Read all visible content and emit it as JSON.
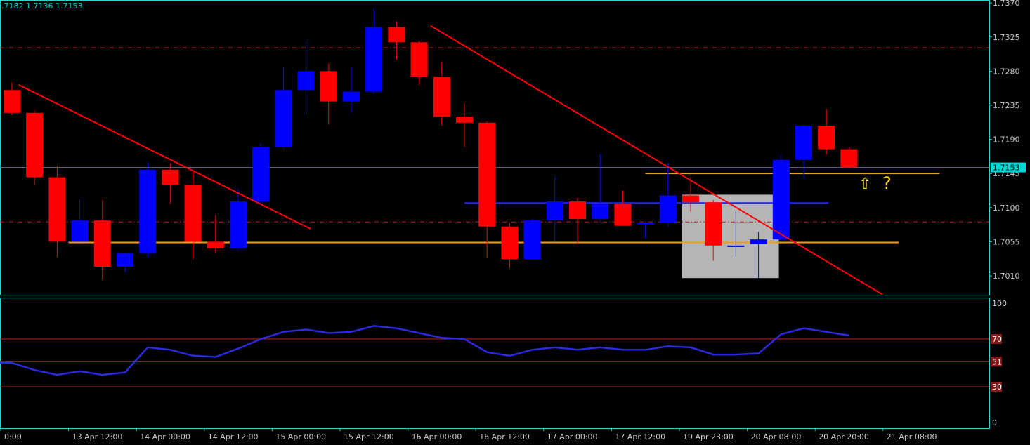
{
  "header": {
    "ohlc_text": ".7182 1.7136 1.7153"
  },
  "colors": {
    "background": "#000000",
    "frame": "#2fd2d2",
    "bull": "#0000ff",
    "bear": "#ff0000",
    "trendline": "#ff0000",
    "support": "#ff9d00",
    "hline": "#2222ff",
    "rsi": "#2a2ae0",
    "level": "#d01616",
    "grey_box": "#bfbfbf",
    "price_badge": "#00d7d7",
    "annotation": "#ffe000"
  },
  "chart_data": [
    {
      "type": "candlestick",
      "symbol_ohlc_text": ".7182 1.7136 1.7153",
      "current_price": 1.7153,
      "current_price_label": "1.7153",
      "ylim": [
        1.6985,
        1.7372
      ],
      "y_ticks": [
        "1.7370",
        "1.7325",
        "1.7280",
        "1.7235",
        "1.7190",
        "1.7145",
        "1.7100",
        "1.7055",
        "1.7010"
      ],
      "x_ticks": [
        {
          "i": 0,
          "label": "0:00"
        },
        {
          "i": 3,
          "label": "13 Apr 12:00"
        },
        {
          "i": 6,
          "label": "14 Apr 00:00"
        },
        {
          "i": 9,
          "label": "14 Apr 12:00"
        },
        {
          "i": 12,
          "label": "15 Apr 00:00"
        },
        {
          "i": 15,
          "label": "15 Apr 12:00"
        },
        {
          "i": 18,
          "label": "16 Apr 00:00"
        },
        {
          "i": 21,
          "label": "16 Apr 12:00"
        },
        {
          "i": 24,
          "label": "17 Apr 00:00"
        },
        {
          "i": 27,
          "label": "17 Apr 12:00"
        },
        {
          "i": 30,
          "label": "19 Apr 23:00"
        },
        {
          "i": 33,
          "label": "20 Apr 08:00"
        },
        {
          "i": 36,
          "label": "20 Apr 20:00"
        },
        {
          "i": 39,
          "label": "21 Apr 08:00"
        }
      ],
      "candles": [
        {
          "o": 1.7255,
          "h": 1.7265,
          "l": 1.7222,
          "c": 1.7225
        },
        {
          "o": 1.7225,
          "h": 1.7228,
          "l": 1.713,
          "c": 1.714
        },
        {
          "o": 1.714,
          "h": 1.7155,
          "l": 1.7035,
          "c": 1.7055
        },
        {
          "o": 1.7055,
          "h": 1.711,
          "l": 1.7055,
          "c": 1.7083
        },
        {
          "o": 1.7083,
          "h": 1.711,
          "l": 1.7005,
          "c": 1.7022
        },
        {
          "o": 1.7022,
          "h": 1.704,
          "l": 1.7015,
          "c": 1.704
        },
        {
          "o": 1.704,
          "h": 1.716,
          "l": 1.7035,
          "c": 1.715
        },
        {
          "o": 1.715,
          "h": 1.7158,
          "l": 1.7105,
          "c": 1.713
        },
        {
          "o": 1.713,
          "h": 1.715,
          "l": 1.7032,
          "c": 1.7055
        },
        {
          "o": 1.7055,
          "h": 1.709,
          "l": 1.704,
          "c": 1.7046
        },
        {
          "o": 1.7046,
          "h": 1.7125,
          "l": 1.7044,
          "c": 1.7108
        },
        {
          "o": 1.7108,
          "h": 1.7185,
          "l": 1.7105,
          "c": 1.718
        },
        {
          "o": 1.718,
          "h": 1.7285,
          "l": 1.7177,
          "c": 1.7255
        },
        {
          "o": 1.7255,
          "h": 1.732,
          "l": 1.7222,
          "c": 1.728
        },
        {
          "o": 1.728,
          "h": 1.729,
          "l": 1.721,
          "c": 1.724
        },
        {
          "o": 1.724,
          "h": 1.7285,
          "l": 1.7225,
          "c": 1.7253
        },
        {
          "o": 1.7253,
          "h": 1.7362,
          "l": 1.725,
          "c": 1.7338
        },
        {
          "o": 1.7338,
          "h": 1.7346,
          "l": 1.7295,
          "c": 1.7318
        },
        {
          "o": 1.7318,
          "h": 1.732,
          "l": 1.7262,
          "c": 1.7273
        },
        {
          "o": 1.7273,
          "h": 1.7292,
          "l": 1.7208,
          "c": 1.722
        },
        {
          "o": 1.722,
          "h": 1.7238,
          "l": 1.718,
          "c": 1.7212
        },
        {
          "o": 1.7212,
          "h": 1.7214,
          "l": 1.7033,
          "c": 1.7075
        },
        {
          "o": 1.7075,
          "h": 1.708,
          "l": 1.702,
          "c": 1.7032
        },
        {
          "o": 1.7032,
          "h": 1.7085,
          "l": 1.7032,
          "c": 1.7083
        },
        {
          "o": 1.7083,
          "h": 1.7142,
          "l": 1.7055,
          "c": 1.7108
        },
        {
          "o": 1.7108,
          "h": 1.7113,
          "l": 1.7052,
          "c": 1.7085
        },
        {
          "o": 1.7085,
          "h": 1.717,
          "l": 1.7082,
          "c": 1.7105
        },
        {
          "o": 1.7105,
          "h": 1.7123,
          "l": 1.7078,
          "c": 1.7076
        },
        {
          "o": 1.7078,
          "h": 1.7082,
          "l": 1.706,
          "c": 1.708
        },
        {
          "o": 1.708,
          "h": 1.716,
          "l": 1.7075,
          "c": 1.7116
        },
        {
          "o": 1.7116,
          "h": 1.714,
          "l": 1.7095,
          "c": 1.7107
        },
        {
          "o": 1.7107,
          "h": 1.711,
          "l": 1.703,
          "c": 1.705
        },
        {
          "o": 1.7048,
          "h": 1.7095,
          "l": 1.7035,
          "c": 1.705
        },
        {
          "o": 1.7052,
          "h": 1.7068,
          "l": 1.7007,
          "c": 1.7058
        },
        {
          "o": 1.7058,
          "h": 1.717,
          "l": 1.7055,
          "c": 1.7163
        },
        {
          "o": 1.7163,
          "h": 1.721,
          "l": 1.7138,
          "c": 1.7208
        },
        {
          "o": 1.7208,
          "h": 1.723,
          "l": 1.717,
          "c": 1.7177
        },
        {
          "o": 1.7177,
          "h": 1.718,
          "l": 1.7152,
          "c": 1.7153
        }
      ],
      "lines": [
        {
          "kind": "trendline",
          "x1": 0.3,
          "p1": 1.7262,
          "x2": 13.2,
          "p2": 1.7072
        },
        {
          "kind": "trendline",
          "x1": 18.5,
          "p1": 1.734,
          "x2": 38.5,
          "p2": 1.6985
        },
        {
          "kind": "support",
          "x1": 2.5,
          "x2": 39.2,
          "p": 1.7054
        },
        {
          "kind": "support",
          "x1": 28.0,
          "x2": 41.0,
          "p": 1.7145
        },
        {
          "kind": "hline",
          "x1": 20.0,
          "x2": 36.1,
          "p": 1.7106
        },
        {
          "kind": "dashdot",
          "x1": 0,
          "x2": 43.6,
          "p": 1.7311
        },
        {
          "kind": "dashdot",
          "x1": 0,
          "x2": 43.6,
          "p": 1.7081
        },
        {
          "kind": "thin",
          "x1": 0,
          "x2": 43.6,
          "p": 1.7153
        }
      ],
      "grey_box": {
        "x1": 30.0,
        "x2": 33.9,
        "p_top": 1.7117,
        "p_bottom": 1.7007
      },
      "annotations": {
        "arrow": "⇧",
        "question": "?"
      }
    },
    {
      "type": "line",
      "name": "RSI",
      "ylim": [
        0,
        100
      ],
      "levels": [
        70,
        51,
        30
      ],
      "y_ticks": [
        "100",
        "70",
        "51",
        "30",
        "0"
      ],
      "series": [
        {
          "values": [
            50,
            44,
            40,
            43,
            40,
            42,
            63,
            61,
            56,
            55,
            62,
            70,
            76,
            78,
            75,
            76,
            81,
            79,
            75,
            71,
            70,
            59,
            56,
            61,
            63,
            61,
            63,
            61,
            61,
            64,
            63,
            57,
            57,
            58,
            74,
            79,
            76,
            73
          ]
        }
      ]
    }
  ]
}
